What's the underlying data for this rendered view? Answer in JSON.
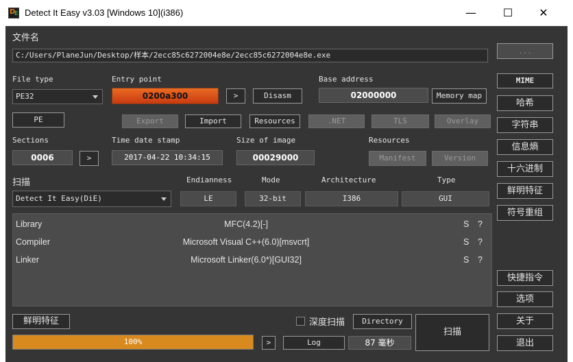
{
  "window": {
    "title": "Detect It Easy v3.03 [Windows 10](i386)",
    "minimize": "—",
    "maximize": "☐",
    "close": "✕"
  },
  "file": {
    "label": "文件名",
    "path": "C:/Users/PlaneJun/Desktop/样本/2ecc85c6272004e8e/2ecc85c6272004e8e.exe",
    "browse": "..."
  },
  "info": {
    "file_type_label": "File type",
    "file_type": "PE32",
    "entry_point_label": "Entry point",
    "entry_point": "0200a300",
    "entry_go": ">",
    "disasm": "Disasm",
    "base_address_label": "Base address",
    "base_address": "02000000",
    "memory_map": "Memory map"
  },
  "pe_row": {
    "pe": "PE",
    "export": "Export",
    "import": "Import",
    "resources": "Resources",
    "net": ".NET",
    "tls": "TLS",
    "overlay": "Overlay"
  },
  "sections": {
    "sections_label": "Sections",
    "sections_value": "0006",
    "sections_go": ">",
    "time_label": "Time date stamp",
    "time_value": "2017-04-22 10:34:15",
    "size_label": "Size of image",
    "size_value": "00029000",
    "resources_label": "Resources",
    "manifest": "Manifest",
    "version": "Version"
  },
  "scan": {
    "label": "扫描",
    "engine": "Detect It Easy(DiE)",
    "endianness_label": "Endianness",
    "endianness": "LE",
    "mode_label": "Mode",
    "mode": "32-bit",
    "arch_label": "Architecture",
    "arch": "I386",
    "type_label": "Type",
    "type": "GUI"
  },
  "results": [
    {
      "kind": "Library",
      "value": "MFC(4.2)[-]",
      "s": "S",
      "q": "?"
    },
    {
      "kind": "Compiler",
      "value": "Microsoft Visual C++(6.0)[msvcrt]",
      "s": "S",
      "q": "?"
    },
    {
      "kind": "Linker",
      "value": "Microsoft Linker(6.0*)[GUI32]",
      "s": "S",
      "q": "?"
    }
  ],
  "bottom": {
    "signatures": "鲜明特征",
    "deep_scan": "深度扫描",
    "directory": "Directory",
    "scan_button": "扫描",
    "progress_text": "100%",
    "progress": 1.0,
    "go": ">",
    "log": "Log",
    "time": "87 毫秒"
  },
  "sidebar": {
    "mime": "MIME",
    "hash": "哈希",
    "strings": "字符串",
    "entropy": "信息熵",
    "hex": "十六进制",
    "signatures": "鲜明特征",
    "demangle": "符号重组",
    "shortcuts": "快捷指令",
    "options": "选项",
    "about": "关于",
    "exit": "退出"
  },
  "colors": {
    "background": "#353535",
    "accent": "#d98a1e",
    "entry_point": "#e2531a"
  }
}
